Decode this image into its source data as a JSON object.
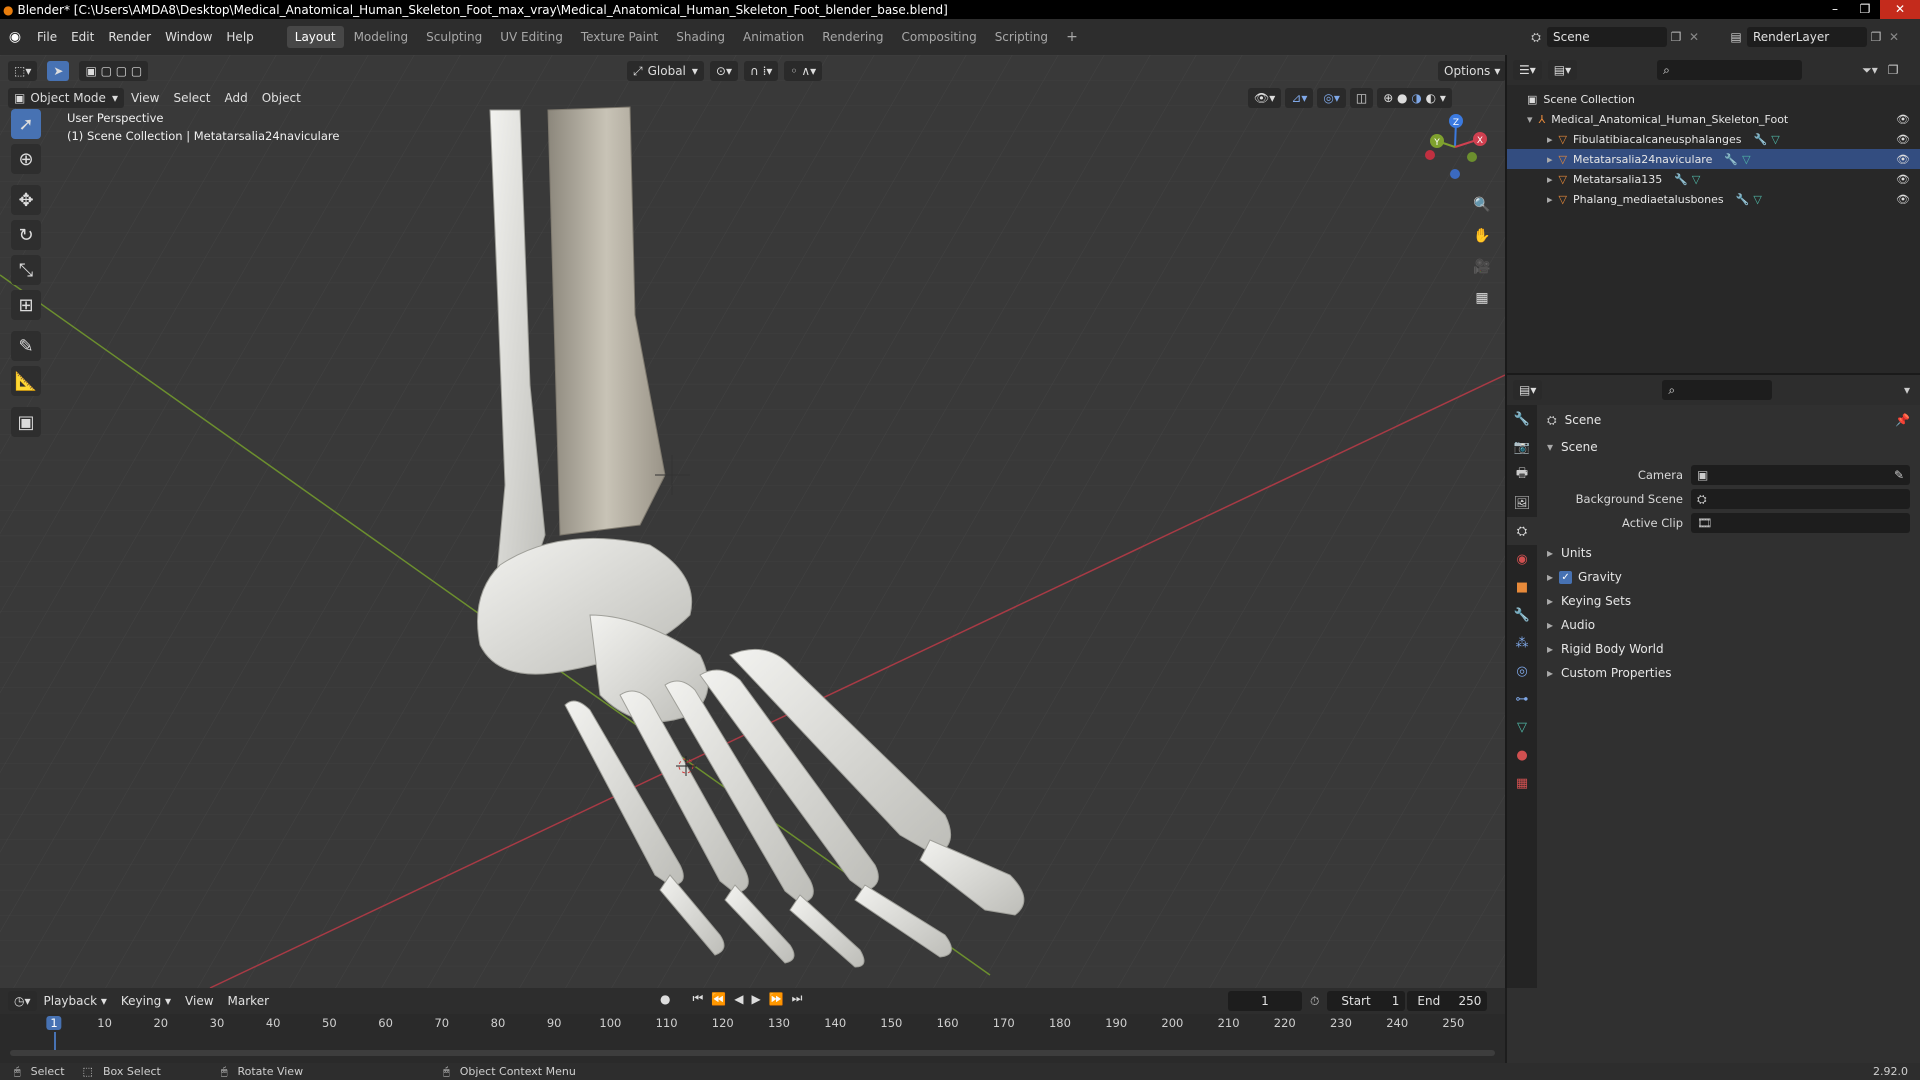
{
  "window": {
    "title": "Blender* [C:\\Users\\AMDA8\\Desktop\\Medical_Anatomical_Human_Skeleton_Foot_max_vray\\Medical_Anatomical_Human_Skeleton_Foot_blender_base.blend]",
    "controls": [
      "–",
      "❐",
      "✕"
    ]
  },
  "menu": [
    "File",
    "Edit",
    "Render",
    "Window",
    "Help"
  ],
  "workspaces": [
    "Layout",
    "Modeling",
    "Sculpting",
    "UV Editing",
    "Texture Paint",
    "Shading",
    "Animation",
    "Rendering",
    "Compositing",
    "Scripting"
  ],
  "active_workspace": "Layout",
  "scene_selector": {
    "label": "Scene",
    "render_layer": "RenderLayer"
  },
  "viewport": {
    "transform_orientation": "Global",
    "options_label": "Options",
    "mode": "Object Mode",
    "menus": [
      "View",
      "Select",
      "Add",
      "Object"
    ],
    "overlay_line1": "User Perspective",
    "overlay_line2": "(1) Scene Collection | Metatarsalia24naviculare",
    "gizmo_axes": {
      "x": "X",
      "y": "Y",
      "z": "Z"
    }
  },
  "outliner": {
    "root": "Scene Collection",
    "collection": "Medical_Anatomical_Human_Skeleton_Foot",
    "objects": [
      "Fibulatibiacalcaneusphalanges",
      "Metatarsalia24naviculare",
      "Metatarsalia135",
      "Phalang_mediaetalusbones"
    ]
  },
  "properties": {
    "context": "Scene",
    "panel": "Scene",
    "fields": [
      {
        "label": "Camera"
      },
      {
        "label": "Background Scene"
      },
      {
        "label": "Active Clip"
      }
    ],
    "subpanels": [
      "Units",
      "Gravity",
      "Keying Sets",
      "Audio",
      "Rigid Body World",
      "Custom Properties"
    ],
    "gravity_checked": true
  },
  "timeline": {
    "menus": [
      "Playback",
      "Keying",
      "View",
      "Marker"
    ],
    "current_frame": "1",
    "start_label": "Start",
    "start": "1",
    "end_label": "End",
    "end": "250",
    "ticks": [
      "1",
      "10",
      "20",
      "30",
      "40",
      "50",
      "60",
      "70",
      "80",
      "90",
      "100",
      "110",
      "120",
      "130",
      "140",
      "150",
      "160",
      "170",
      "180",
      "190",
      "200",
      "210",
      "220",
      "230",
      "240",
      "250"
    ]
  },
  "statusbar": {
    "items": [
      "Select",
      "Box Select",
      "Rotate View",
      "Object Context Menu"
    ],
    "version": "2.92.0"
  },
  "colors": {
    "accent": "#4772b3",
    "x_axis": "#a83a45",
    "y_axis": "#6c8f2e",
    "object_icon": "#e88a3a",
    "mesh_icon": "#4fb7a6"
  }
}
